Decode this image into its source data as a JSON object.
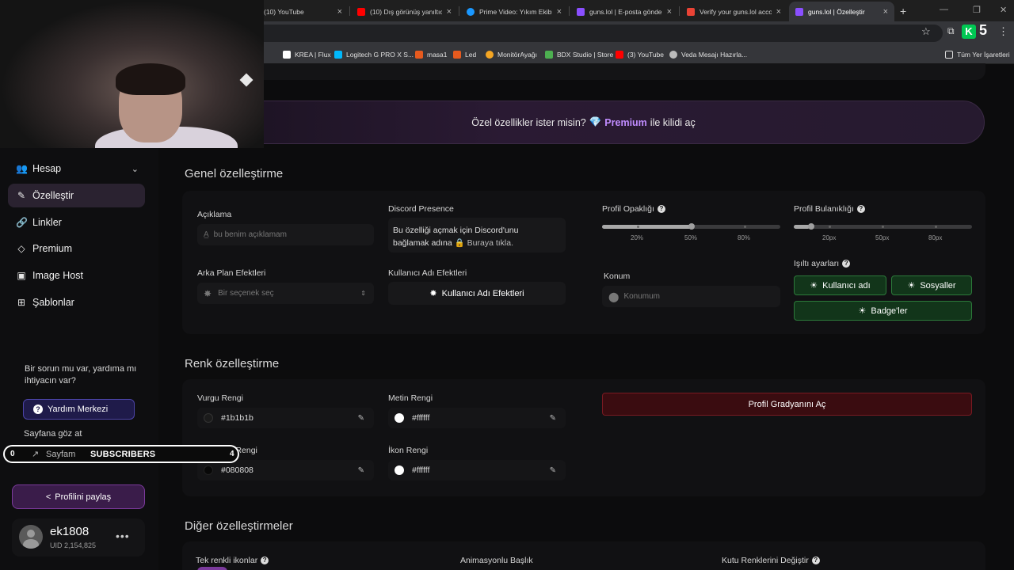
{
  "browser": {
    "tabs": [
      {
        "label": "(10) YouTube",
        "color": "#ff0000"
      },
      {
        "label": "(10) Dış görünüş yanıltıcı",
        "color": "#ff0000"
      },
      {
        "label": "Prime Video: Yıkım Ekibi",
        "color": "#1a98ff"
      },
      {
        "label": "guns.lol | E-posta gönder",
        "color": "#8a4fff"
      },
      {
        "label": "Verify your guns.lol accou",
        "color": "#ea4335"
      },
      {
        "label": "guns.lol | Özelleştir",
        "color": "#8a4fff"
      }
    ],
    "new_tab": "+",
    "ext_badge": "5",
    "bookmarks": [
      {
        "label": "KREA | Flux",
        "color": "#ffffff"
      },
      {
        "label": "Logitech G PRO X S...",
        "color": "#00b8fc"
      },
      {
        "label": "masa1",
        "color": "#e65a1e"
      },
      {
        "label": "Led",
        "color": "#e65a1e"
      },
      {
        "label": "MonitörAyağı",
        "color": "#f5a623"
      },
      {
        "label": "BDX Studio | Store",
        "color": "#4caf50"
      },
      {
        "label": "(3) YouTube",
        "color": "#ff0000"
      },
      {
        "label": "Veda Mesajı Hazırla...",
        "color": "#bbbbbb"
      },
      {
        "label": "Tüm Yer İşaretleri",
        "color": "#dddddd"
      }
    ]
  },
  "sidebar": {
    "items": [
      {
        "label": "Hesap",
        "icon": "users-icon"
      },
      {
        "label": "Özelleştir",
        "icon": "brush-icon"
      },
      {
        "label": "Linkler",
        "icon": "link-icon"
      },
      {
        "label": "Premium",
        "icon": "diamond-icon"
      },
      {
        "label": "Image Host",
        "icon": "image-icon"
      },
      {
        "label": "Şablonlar",
        "icon": "template-icon"
      }
    ],
    "help_text": "Bir sorun mu var, yardıma mı ihtiyacın var?",
    "help_button": "Yardım Merkezi",
    "see_page_label": "Sayfana göz at",
    "my_page_button": "Sayfam",
    "share_button": "Profilini paylaş",
    "user": {
      "name": "ek1808",
      "uid": "UID 2,154,825"
    }
  },
  "overlay": {
    "left_count": "0",
    "label": "SUBSCRIBERS",
    "right_count": "4"
  },
  "premium_banner": {
    "before": "Özel özellikler ister misin?",
    "premium": "Premium",
    "after": "ile kilidi aç"
  },
  "general": {
    "title": "Genel özelleştirme",
    "description_label": "Açıklama",
    "description_placeholder": "bu benim açıklamam",
    "discord_label": "Discord Presence",
    "discord_text_1": "Bu özelliği açmak için Discord'unu",
    "discord_text_2": "bağlamak adına",
    "discord_link": "Buraya tıkla.",
    "opacity_label": "Profil Opaklığı",
    "opacity_value": 0.5,
    "opacity_ticks": [
      "20%",
      "50%",
      "80%"
    ],
    "blur_label": "Profil Bulanıklığı",
    "blur_value": 0,
    "blur_ticks": [
      "20px",
      "50px",
      "80px"
    ],
    "bg_effects_label": "Arka Plan Efektleri",
    "bg_effects_placeholder": "Bir seçenek seç",
    "username_effects_label": "Kullanıcı Adı Efektleri",
    "username_effects_button": "Kullanıcı Adı Efektleri",
    "location_label": "Konum",
    "location_placeholder": "Konumum",
    "glow_label": "Işıltı ayarları",
    "glow_buttons": [
      "Kullanıcı adı",
      "Sosyaller",
      "Badge'ler"
    ]
  },
  "color": {
    "title": "Renk özelleştirme",
    "accent_label": "Vurgu Rengi",
    "accent_value": "#1b1b1b",
    "text_label": "Metin Rengi",
    "text_value": "#ffffff",
    "bg_label": "Arka Plan Rengi",
    "bg_value": "#080808",
    "icon_label": "İkon Rengi",
    "icon_value": "#ffffff",
    "gradient_button": "Profil Gradyanını Aç"
  },
  "other": {
    "title": "Diğer özelleştirmeler",
    "mono_icons_label": "Tek renkli ikonlar",
    "animated_title_label": "Animasyonlu Başlık",
    "box_colors_label": "Kutu Renklerini Değiştir"
  }
}
